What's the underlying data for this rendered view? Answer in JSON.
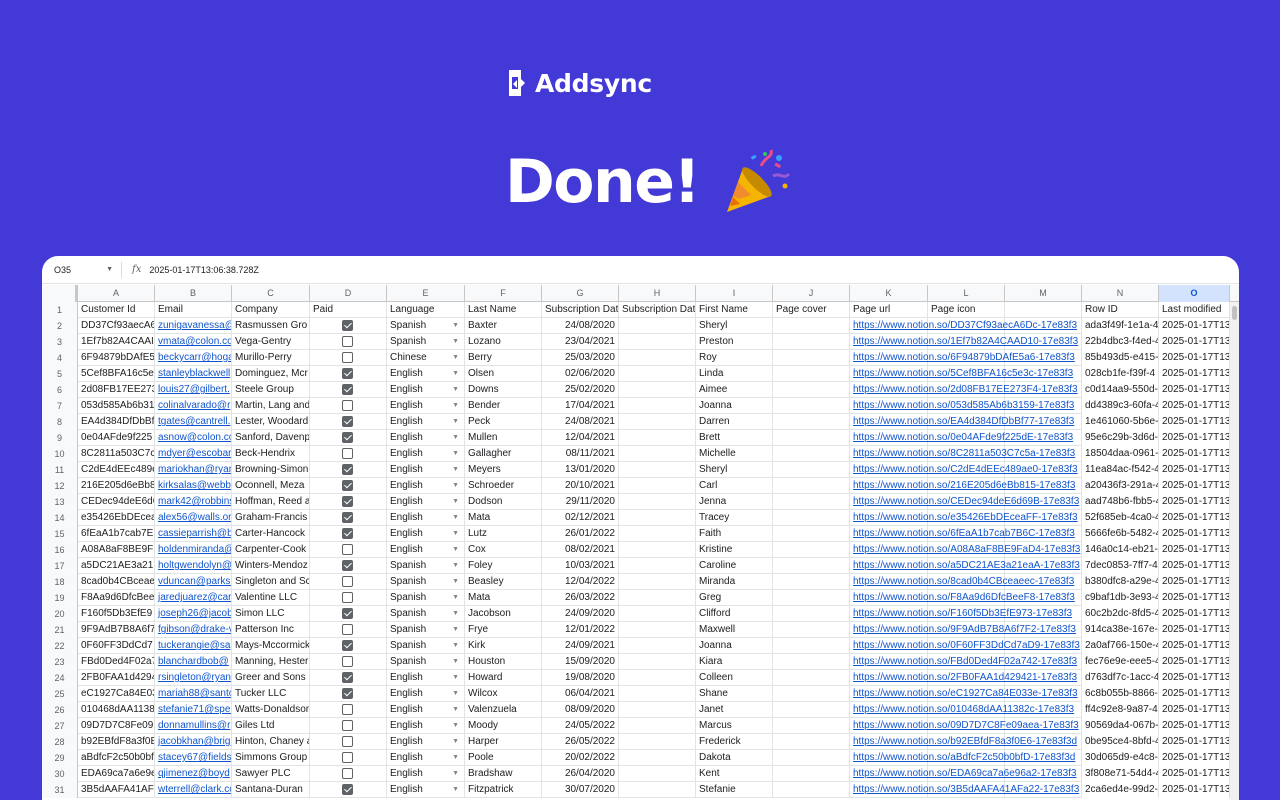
{
  "brand": {
    "name": "Addsync"
  },
  "headline": {
    "text": "Done!"
  },
  "colors": {
    "background": "#4339d6",
    "link": "#1155cc",
    "selected_column": "#d3e3fd"
  },
  "formula_bar": {
    "cell_ref": "O35",
    "fx": "fx",
    "value": "2025-01-17T13:06:38.728Z"
  },
  "columns": [
    "A",
    "B",
    "C",
    "D",
    "E",
    "F",
    "G",
    "H",
    "I",
    "J",
    "K",
    "L",
    "M",
    "N",
    "O"
  ],
  "selected_column": "O",
  "header_row": {
    "number": "1",
    "cells": [
      "Customer Id",
      "Email",
      "Company",
      "Paid",
      "Language",
      "Last Name",
      "Subscription Dat",
      "Subscription Dat",
      "First Name",
      "Page cover",
      "Page url",
      "Page icon",
      "",
      "Row ID",
      "Last modified"
    ]
  },
  "rows": [
    {
      "n": "2",
      "id": "DD37Cf93aecA6",
      "email": "zunigavanessa@",
      "company": "Rasmussen Gro",
      "paid": true,
      "lang": "Spanish",
      "last": "Baxter",
      "date": "24/08/2020",
      "first": "Sheryl",
      "url": "https://www.notion.so/DD37Cf93aecA6Dc-17e83f3",
      "rowid": "ada3f49f-1e1a-4",
      "mod": "2025-01-17T13"
    },
    {
      "n": "3",
      "id": "1Ef7b82A4CAAI",
      "email": "vmata@colon.co",
      "company": "Vega-Gentry",
      "paid": false,
      "lang": "Spanish",
      "last": "Lozano",
      "date": "23/04/2021",
      "first": "Preston",
      "url": "https://www.notion.so/1Ef7b82A4CAAD10-17e83f3",
      "rowid": "22b4dbc3-f4ed-4",
      "mod": "2025-01-17T13"
    },
    {
      "n": "4",
      "id": "6F94879bDAfE5",
      "email": "beckycarr@hoga",
      "company": "Murillo-Perry",
      "paid": false,
      "lang": "Chinese",
      "last": "Berry",
      "date": "25/03/2020",
      "first": "Roy",
      "url": "https://www.notion.so/6F94879bDAfE5a6-17e83f3",
      "rowid": "85b493d5-e415-",
      "mod": "2025-01-17T13"
    },
    {
      "n": "5",
      "id": "5Cef8BFA16c5e",
      "email": "stanleyblackwell",
      "company": "Dominguez, Mcr",
      "paid": true,
      "lang": "English",
      "last": "Olsen",
      "date": "02/06/2020",
      "first": "Linda",
      "url": "https://www.notion.so/5Cef8BFA16c5e3c-17e83f3",
      "rowid": "028cb1fe-f39f-4",
      "mod": "2025-01-17T13"
    },
    {
      "n": "6",
      "id": "2d08FB17EE273",
      "email": "louis27@gilbert.",
      "company": "Steele Group",
      "paid": true,
      "lang": "English",
      "last": "Downs",
      "date": "25/02/2020",
      "first": "Aimee",
      "url": "https://www.notion.so/2d08FB17EE273F4-17e83f3",
      "rowid": "c0d14aa9-550d-",
      "mod": "2025-01-17T13"
    },
    {
      "n": "7",
      "id": "053d585Ab6b31",
      "email": "colinalvarado@r",
      "company": "Martin, Lang and",
      "paid": false,
      "lang": "English",
      "last": "Bender",
      "date": "17/04/2021",
      "first": "Joanna",
      "url": "https://www.notion.so/053d585Ab6b3159-17e83f3",
      "rowid": "dd4389c3-60fa-4",
      "mod": "2025-01-17T13"
    },
    {
      "n": "8",
      "id": "EA4d384DfDbBf",
      "email": "tgates@cantrell.",
      "company": "Lester, Woodard",
      "paid": true,
      "lang": "English",
      "last": "Peck",
      "date": "24/08/2021",
      "first": "Darren",
      "url": "https://www.notion.so/EA4d384DfDbBf77-17e83f3",
      "rowid": "1e461060-5b6e-",
      "mod": "2025-01-17T13"
    },
    {
      "n": "9",
      "id": "0e04AFde9f225",
      "email": "asnow@colon.co",
      "company": "Sanford, Davenp",
      "paid": true,
      "lang": "English",
      "last": "Mullen",
      "date": "12/04/2021",
      "first": "Brett",
      "url": "https://www.notion.so/0e04AFde9f225dE-17e83f3",
      "rowid": "95e6c29b-3d6d-",
      "mod": "2025-01-17T13"
    },
    {
      "n": "10",
      "id": "8C2811a503C7c",
      "email": "mdyer@escobar",
      "company": "Beck-Hendrix",
      "paid": false,
      "lang": "English",
      "last": "Gallagher",
      "date": "08/11/2021",
      "first": "Michelle",
      "url": "https://www.notion.so/8C2811a503C7c5a-17e83f3",
      "rowid": "18504daa-0961-",
      "mod": "2025-01-17T13"
    },
    {
      "n": "11",
      "id": "C2dE4dEEc489e",
      "email": "mariokhan@ryan",
      "company": "Browning-Simon",
      "paid": true,
      "lang": "English",
      "last": "Meyers",
      "date": "13/01/2020",
      "first": "Sheryl",
      "url": "https://www.notion.so/C2dE4dEEc489ae0-17e83f3",
      "rowid": "11ea84ac-f542-4",
      "mod": "2025-01-17T13"
    },
    {
      "n": "12",
      "id": "216E205d6eBb8",
      "email": "kirksalas@webb",
      "company": "Oconnell, Meza",
      "paid": true,
      "lang": "English",
      "last": "Schroeder",
      "date": "20/10/2021",
      "first": "Carl",
      "url": "https://www.notion.so/216E205d6eBb815-17e83f3",
      "rowid": "a20436f3-291a-4",
      "mod": "2025-01-17T13"
    },
    {
      "n": "13",
      "id": "CEDec94deE6d6",
      "email": "mark42@robbins",
      "company": "Hoffman, Reed a",
      "paid": true,
      "lang": "English",
      "last": "Dodson",
      "date": "29/11/2020",
      "first": "Jenna",
      "url": "https://www.notion.so/CEDec94deE6d69B-17e83f3",
      "rowid": "aad748b6-fbb5-4",
      "mod": "2025-01-17T13"
    },
    {
      "n": "14",
      "id": "e35426EbDEcea",
      "email": "alex56@walls.or",
      "company": "Graham-Francis",
      "paid": true,
      "lang": "English",
      "last": "Mata",
      "date": "02/12/2021",
      "first": "Tracey",
      "url": "https://www.notion.so/e35426EbDEceaFF-17e83f3",
      "rowid": "52f685eb-4ca0-4",
      "mod": "2025-01-17T13"
    },
    {
      "n": "15",
      "id": "6fEaA1b7cab7E",
      "email": "cassieparrish@b",
      "company": "Carter-Hancock",
      "paid": true,
      "lang": "English",
      "last": "Lutz",
      "date": "26/01/2022",
      "first": "Faith",
      "url": "https://www.notion.so/6fEaA1b7cab7B6C-17e83f3",
      "rowid": "5666fe6b-5482-4",
      "mod": "2025-01-17T13"
    },
    {
      "n": "16",
      "id": "A08A8aF8BE9F",
      "email": "holdenmiranda@",
      "company": "Carpenter-Cook",
      "paid": false,
      "lang": "English",
      "last": "Cox",
      "date": "08/02/2021",
      "first": "Kristine",
      "url": "https://www.notion.so/A08A8aF8BE9FaD4-17e83f3",
      "rowid": "146a0c14-eb21-",
      "mod": "2025-01-17T13"
    },
    {
      "n": "17",
      "id": "a5DC21AE3a21",
      "email": "holtgwendolyn@",
      "company": "Winters-Mendoz",
      "paid": true,
      "lang": "Spanish",
      "last": "Foley",
      "date": "10/03/2021",
      "first": "Caroline",
      "url": "https://www.notion.so/a5DC21AE3a21eaA-17e83f3",
      "rowid": "7dec0853-7ff7-4",
      "mod": "2025-01-17T13"
    },
    {
      "n": "18",
      "id": "8cad0b4CBceae",
      "email": "vduncan@parks.",
      "company": "Singleton and Sc",
      "paid": false,
      "lang": "Spanish",
      "last": "Beasley",
      "date": "12/04/2022",
      "first": "Miranda",
      "url": "https://www.notion.so/8cad0b4CBceaeec-17e83f3",
      "rowid": "b380dfc8-a29e-4",
      "mod": "2025-01-17T13"
    },
    {
      "n": "19",
      "id": "F8Aa9d6DfcBee",
      "email": "jaredjuarez@car",
      "company": "Valentine LLC",
      "paid": false,
      "lang": "Spanish",
      "last": "Mata",
      "date": "26/03/2022",
      "first": "Greg",
      "url": "https://www.notion.so/F8Aa9d6DfcBeeF8-17e83f3",
      "rowid": "c9baf1db-3e93-4",
      "mod": "2025-01-17T13"
    },
    {
      "n": "20",
      "id": "F160f5Db3EfE9",
      "email": "joseph26@jacob",
      "company": "Simon LLC",
      "paid": true,
      "lang": "Spanish",
      "last": "Jacobson",
      "date": "24/09/2020",
      "first": "Clifford",
      "url": "https://www.notion.so/F160f5Db3EfE973-17e83f3",
      "rowid": "60c2b2dc-8fd5-4",
      "mod": "2025-01-17T13"
    },
    {
      "n": "21",
      "id": "9F9AdB7B8A6f7",
      "email": "fgibson@drake-v",
      "company": "Patterson Inc",
      "paid": false,
      "lang": "Spanish",
      "last": "Frye",
      "date": "12/01/2022",
      "first": "Maxwell",
      "url": "https://www.notion.so/9F9AdB7B8A6f7F2-17e83f3",
      "rowid": "914ca38e-167e-",
      "mod": "2025-01-17T13"
    },
    {
      "n": "22",
      "id": "0F60FF3DdCd7",
      "email": "tuckerangie@sa",
      "company": "Mays-Mccormick",
      "paid": true,
      "lang": "Spanish",
      "last": "Kirk",
      "date": "24/09/2021",
      "first": "Joanna",
      "url": "https://www.notion.so/0F60FF3DdCd7aD9-17e83f3",
      "rowid": "2a0af766-150e-4",
      "mod": "2025-01-17T13"
    },
    {
      "n": "23",
      "id": "FBd0Ded4F02a7",
      "email": "blanchardbob@",
      "company": "Manning, Hester",
      "paid": false,
      "lang": "Spanish",
      "last": "Houston",
      "date": "15/09/2020",
      "first": "Kiara",
      "url": "https://www.notion.so/FBd0Ded4F02a742-17e83f3",
      "rowid": "fec76e9e-eee5-4",
      "mod": "2025-01-17T13"
    },
    {
      "n": "24",
      "id": "2FB0FAA1d4294",
      "email": "rsingleton@ryan",
      "company": "Greer and Sons",
      "paid": true,
      "lang": "English",
      "last": "Howard",
      "date": "19/08/2020",
      "first": "Colleen",
      "url": "https://www.notion.so/2FB0FAA1d429421-17e83f3",
      "rowid": "d763df7c-1acc-4",
      "mod": "2025-01-17T13"
    },
    {
      "n": "25",
      "id": "eC1927Ca84E03",
      "email": "mariah88@santo",
      "company": "Tucker LLC",
      "paid": true,
      "lang": "English",
      "last": "Wilcox",
      "date": "06/04/2021",
      "first": "Shane",
      "url": "https://www.notion.so/eC1927Ca84E033e-17e83f3",
      "rowid": "6c8b055b-8866-",
      "mod": "2025-01-17T13"
    },
    {
      "n": "26",
      "id": "010468dAA1138",
      "email": "stefanie71@spen",
      "company": "Watts-Donaldson",
      "paid": false,
      "lang": "English",
      "last": "Valenzuela",
      "date": "08/09/2020",
      "first": "Janet",
      "url": "https://www.notion.so/010468dAA11382c-17e83f3",
      "rowid": "ff4c92e8-9a87-4",
      "mod": "2025-01-17T13"
    },
    {
      "n": "27",
      "id": "09D7D7C8Fe09",
      "email": "donnamullins@r",
      "company": "Giles Ltd",
      "paid": false,
      "lang": "English",
      "last": "Moody",
      "date": "24/05/2022",
      "first": "Marcus",
      "url": "https://www.notion.so/09D7D7C8Fe09aea-17e83f3",
      "rowid": "90569da4-067b-",
      "mod": "2025-01-17T13"
    },
    {
      "n": "28",
      "id": "b92EBfdF8a3f0E",
      "email": "jacobkhan@brig",
      "company": "Hinton, Chaney a",
      "paid": false,
      "lang": "English",
      "last": "Harper",
      "date": "26/05/2022",
      "first": "Frederick",
      "url": "https://www.notion.so/b92EBfdF8a3f0E6-17e83f3d",
      "rowid": "0be95ce4-8bfd-4",
      "mod": "2025-01-17T13"
    },
    {
      "n": "29",
      "id": "aBdfcF2c50b0bf",
      "email": "stacey67@fields",
      "company": "Simmons Group",
      "paid": false,
      "lang": "English",
      "last": "Poole",
      "date": "20/02/2022",
      "first": "Dakota",
      "url": "https://www.notion.so/aBdfcF2c50b0bfD-17e83f3d",
      "rowid": "30d065d9-e4c8-",
      "mod": "2025-01-17T13"
    },
    {
      "n": "30",
      "id": "EDA69ca7a6e9e",
      "email": "qjimenez@boyd",
      "company": "Sawyer PLC",
      "paid": false,
      "lang": "English",
      "last": "Bradshaw",
      "date": "26/04/2020",
      "first": "Kent",
      "url": "https://www.notion.so/EDA69ca7a6e96a2-17e83f3",
      "rowid": "3f808e71-54d4-4",
      "mod": "2025-01-17T13"
    },
    {
      "n": "31",
      "id": "3B5dAAFA41AF",
      "email": "wterrell@clark.co",
      "company": "Santana-Duran",
      "paid": true,
      "lang": "English",
      "last": "Fitzpatrick",
      "date": "30/07/2020",
      "first": "Stefanie",
      "url": "https://www.notion.so/3B5dAAFA41AFa22-17e83f3",
      "rowid": "2ca6ed4e-99d2-",
      "mod": "2025-01-17T13"
    }
  ]
}
